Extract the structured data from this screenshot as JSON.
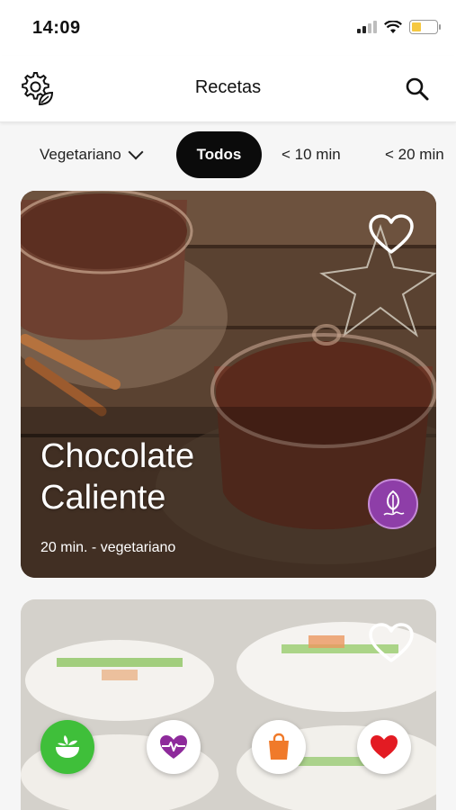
{
  "status_bar": {
    "time": "14:09"
  },
  "header": {
    "title": "Recetas"
  },
  "filters": [
    {
      "label": "Vegetariano"
    },
    {
      "label": "Todos"
    },
    {
      "label": "< 10 min"
    },
    {
      "label": "< 20 min"
    }
  ],
  "recipes": [
    {
      "title": "Chocolate Caliente",
      "meta": "20 min. - vegetariano"
    },
    {
      "title": "",
      "meta": ""
    }
  ],
  "colors": {
    "accent_green": "#3fbf3a",
    "badge_purple": "#8e3ea8",
    "health_purple": "#8e2a9b",
    "shop_orange": "#f07a2a",
    "heart_red": "#e31b23"
  },
  "icons": {
    "settings": "gear-leaf-icon",
    "search": "search-icon",
    "favorite": "heart-outline-icon",
    "badge": "leaf-badge-icon",
    "nav": [
      "bowl-icon",
      "heart-pulse-icon",
      "shopping-bag-icon",
      "heart-filled-icon"
    ]
  }
}
